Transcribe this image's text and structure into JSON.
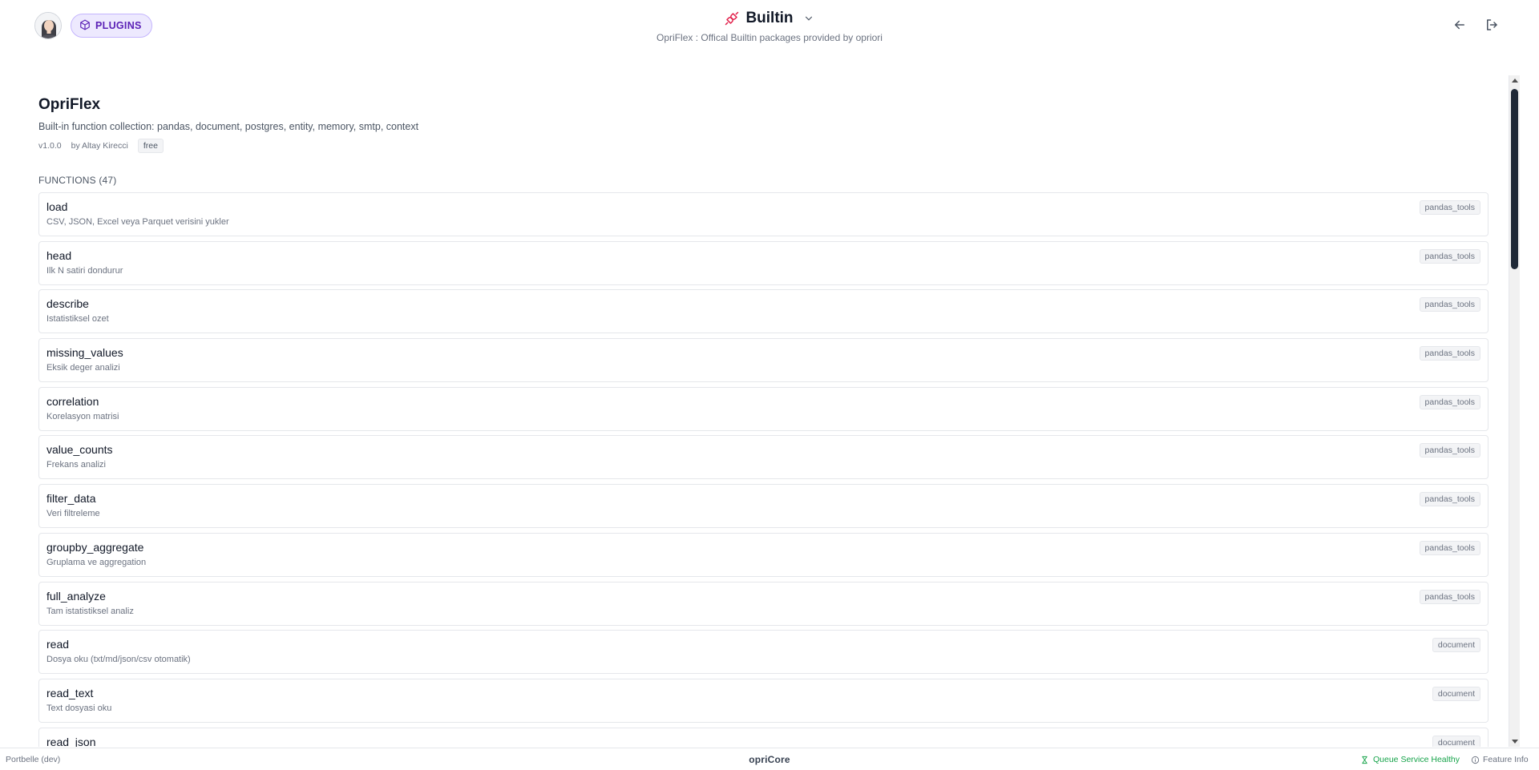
{
  "header": {
    "plugins_label": "PLUGINS",
    "title": "Builtin",
    "subtitle": "OpriFlex : Offical Builtin packages provided by opriori"
  },
  "plugin": {
    "name": "OpriFlex",
    "description": "Built-in function collection: pandas, document, postgres, entity, memory, smtp, context",
    "version": "v1.0.0",
    "author": "by Altay Kirecci",
    "license_badge": "free"
  },
  "functions": {
    "section_title": "FUNCTIONS (47)",
    "items": [
      {
        "name": "load",
        "description": "CSV, JSON, Excel veya Parquet verisini yukler",
        "tag": "pandas_tools"
      },
      {
        "name": "head",
        "description": "Ilk N satiri dondurur",
        "tag": "pandas_tools"
      },
      {
        "name": "describe",
        "description": "Istatistiksel ozet",
        "tag": "pandas_tools"
      },
      {
        "name": "missing_values",
        "description": "Eksik deger analizi",
        "tag": "pandas_tools"
      },
      {
        "name": "correlation",
        "description": "Korelasyon matrisi",
        "tag": "pandas_tools"
      },
      {
        "name": "value_counts",
        "description": "Frekans analizi",
        "tag": "pandas_tools"
      },
      {
        "name": "filter_data",
        "description": "Veri filtreleme",
        "tag": "pandas_tools"
      },
      {
        "name": "groupby_aggregate",
        "description": "Gruplama ve aggregation",
        "tag": "pandas_tools"
      },
      {
        "name": "full_analyze",
        "description": "Tam istatistiksel analiz",
        "tag": "pandas_tools"
      },
      {
        "name": "read",
        "description": "Dosya oku (txt/md/json/csv otomatik)",
        "tag": "document"
      },
      {
        "name": "read_text",
        "description": "Text dosyasi oku",
        "tag": "document"
      },
      {
        "name": "read_json",
        "description": "",
        "tag": "document"
      }
    ]
  },
  "footer": {
    "env": "Portbelle (dev)",
    "brand": "opriCore",
    "queue_status": "Queue Service Healthy",
    "feature_info": "Feature Info"
  },
  "colors": {
    "accent": "#5b21b6",
    "accent_bg": "#ede9fe",
    "plug_icon": "#e11d48",
    "healthy": "#16a34a"
  },
  "icons": {
    "plugins": "package-icon",
    "title": "plug-icon",
    "dropdown": "chevron-down-icon",
    "back": "arrow-left-icon",
    "logout": "logout-icon",
    "queue": "hourglass-icon",
    "feature": "info-icon"
  }
}
